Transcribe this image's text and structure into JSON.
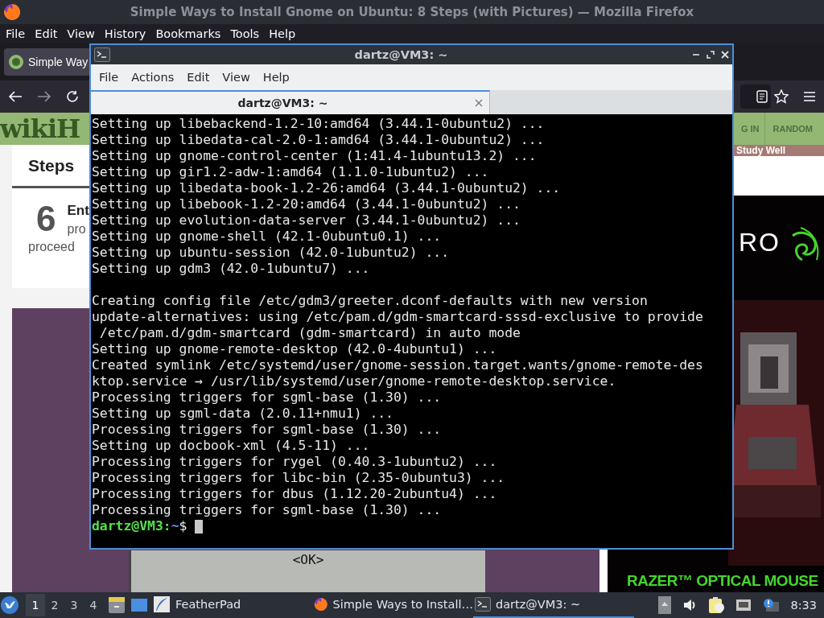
{
  "firefox": {
    "title": "Simple Ways to Install Gnome on Ubuntu: 8 Steps (with Pictures) — Mozilla Firefox",
    "menu": [
      "File",
      "Edit",
      "View",
      "History",
      "Bookmarks",
      "Tools",
      "Help"
    ],
    "tab": "Simple Way",
    "page": {
      "logo": "wikiH",
      "nav": [
        "G IN",
        "RANDOM"
      ],
      "banner": "Study Well",
      "steps_heading": "Steps",
      "step_number": "6",
      "step_title": "Ent",
      "step_text": [
        "pro",
        "proceed"
      ],
      "dialog_button": "<OK>",
      "ad": {
        "kind": "picture",
        "brand_text": "RO",
        "caption": "RAZER™ OPTICAL MOUSE"
      }
    }
  },
  "terminal": {
    "title": "dartz@VM3: ~",
    "menu": [
      "File",
      "Actions",
      "Edit",
      "View",
      "Help"
    ],
    "tabs": [
      {
        "label": "dartz@VM3: ~",
        "selected": true
      }
    ],
    "output_blocks": [
      [
        "Setting up libebackend-1.2-10:amd64 (3.44.1-0ubuntu2) ...",
        "Setting up libedata-cal-2.0-1:amd64 (3.44.1-0ubuntu2) ...",
        "Setting up gnome-control-center (1:41.4-1ubuntu13.2) ...",
        "Setting up gir1.2-adw-1:amd64 (1.1.0-1ubuntu2) ...",
        "Setting up libedata-book-1.2-26:amd64 (3.44.1-0ubuntu2) ...",
        "Setting up libebook-1.2-20:amd64 (3.44.1-0ubuntu2) ...",
        "Setting up evolution-data-server (3.44.1-0ubuntu2) ...",
        "Setting up gnome-shell (42.1-0ubuntu0.1) ...",
        "Setting up ubuntu-session (42.0-1ubuntu2) ...",
        "Setting up gdm3 (42.0-1ubuntu7) ..."
      ],
      [
        "Creating config file /etc/gdm3/greeter.dconf-defaults with new version",
        "update-alternatives: using /etc/pam.d/gdm-smartcard-sssd-exclusive to provide",
        " /etc/pam.d/gdm-smartcard (gdm-smartcard) in auto mode",
        "Setting up gnome-remote-desktop (42.0-4ubuntu1) ...",
        "Created symlink /etc/systemd/user/gnome-session.target.wants/gnome-remote-des",
        "ktop.service → /usr/lib/systemd/user/gnome-remote-desktop.service.",
        "Processing triggers for sgml-base (1.30) ...",
        "Setting up sgml-data (2.0.11+nmu1) ...",
        "Processing triggers for sgml-base (1.30) ...",
        "Setting up docbook-xml (4.5-11) ...",
        "Processing triggers for rygel (0.40.3-1ubuntu2) ...",
        "Processing triggers for libc-bin (2.35-0ubuntu3) ...",
        "Processing triggers for dbus (1.12.20-2ubuntu4) ...",
        "Processing triggers for sgml-base (1.30) ..."
      ]
    ],
    "prompt": {
      "user": "dartz@VM3",
      "separator": ":",
      "path": "~",
      "symbol": "$"
    }
  },
  "taskbar": {
    "workspaces": [
      {
        "label": "1",
        "selected": true
      },
      {
        "label": "2",
        "selected": false
      },
      {
        "label": "3",
        "selected": false
      },
      {
        "label": "4",
        "selected": false
      }
    ],
    "apps": [
      {
        "label": "FeatherPad",
        "kind": "featherpad",
        "selected": false
      },
      {
        "label": "Simple Ways to Install…",
        "kind": "firefox",
        "selected": false
      },
      {
        "label": "dartz@VM3: ~",
        "kind": "terminal",
        "selected": true
      }
    ],
    "clock": "8:33"
  }
}
